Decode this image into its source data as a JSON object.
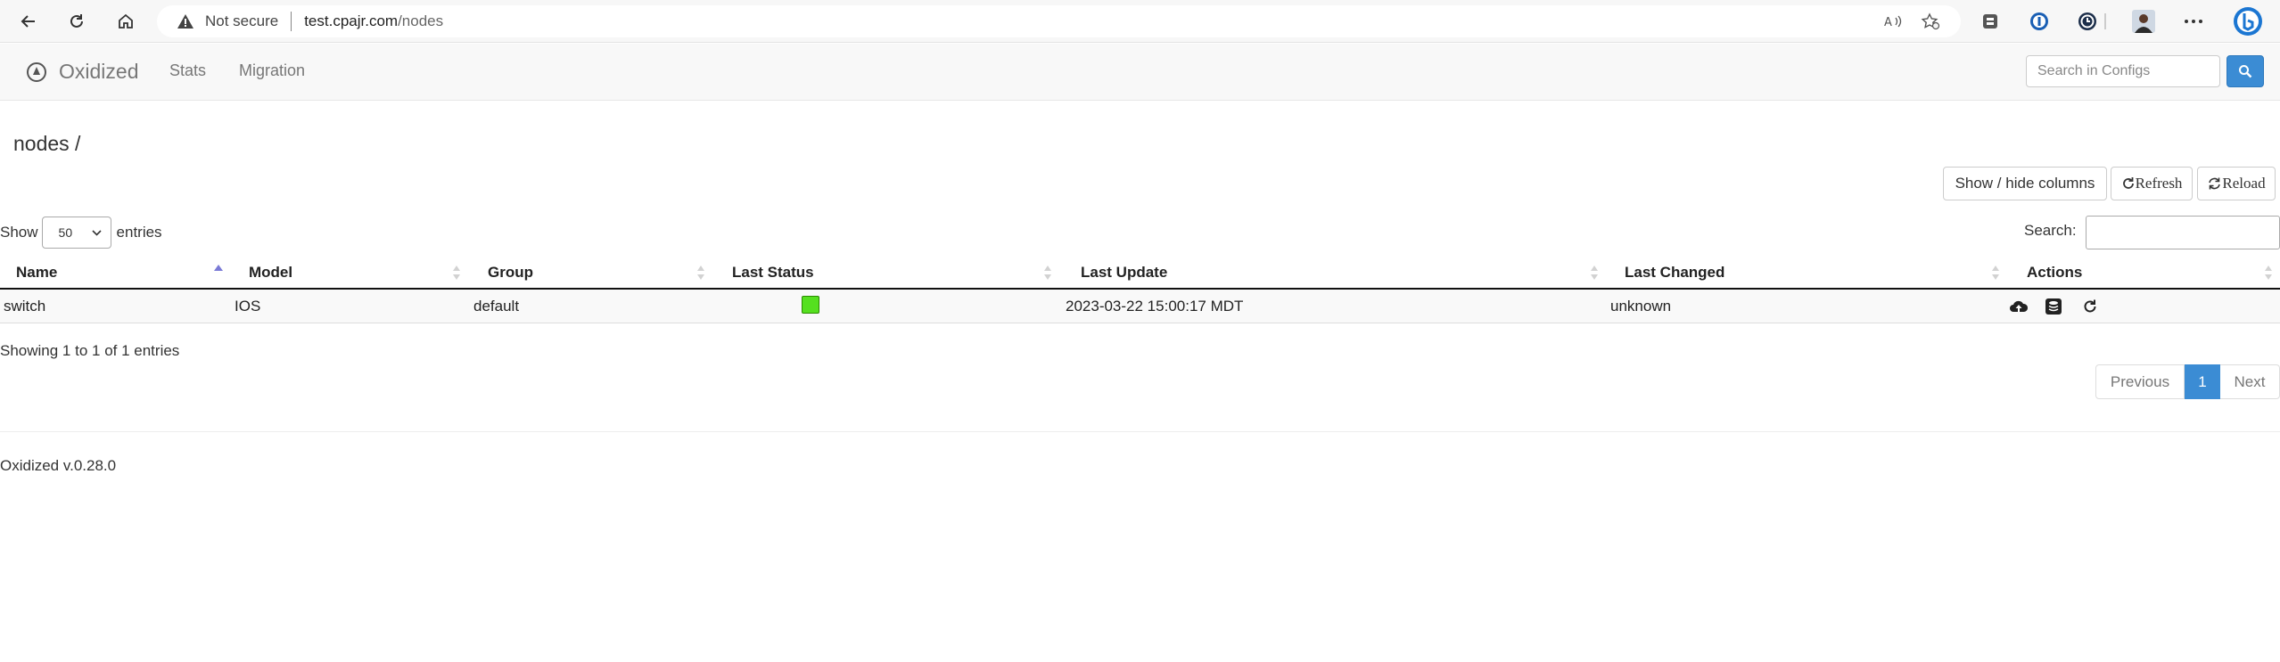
{
  "browser": {
    "security_label": "Not secure",
    "url_host": "test.cpajr.com",
    "url_path": "/nodes"
  },
  "navbar": {
    "brand": "Oxidized",
    "links": [
      "Stats",
      "Migration"
    ],
    "search_placeholder": "Search in Configs"
  },
  "page": {
    "title": "nodes /",
    "buttons": {
      "show_hide": "Show / hide columns",
      "refresh": "Refresh",
      "reload": "Reload"
    },
    "length": {
      "prefix": "Show",
      "value": "50",
      "suffix": "entries"
    },
    "search_label": "Search:"
  },
  "table": {
    "columns": [
      "Name",
      "Model",
      "Group",
      "Last Status",
      "Last Update",
      "Last Changed",
      "Actions"
    ],
    "sorted_column": "Name",
    "sort_direction": "ascending",
    "rows": [
      {
        "name": "switch",
        "model": "IOS",
        "group": "default",
        "last_status": "success",
        "last_update": "2023-03-22 15:00:17 MDT",
        "last_changed": "unknown",
        "actions": [
          "cloud-upload-icon",
          "database-icon",
          "refresh-icon"
        ]
      }
    ],
    "info": "Showing 1 to 1 of 1 entries"
  },
  "pagination": {
    "previous": "Previous",
    "current": "1",
    "next": "Next"
  },
  "footer": {
    "version": "Oxidized v.0.28.0"
  },
  "colors": {
    "accent": "#3b8cd4",
    "status_ok": "#55e01f"
  }
}
